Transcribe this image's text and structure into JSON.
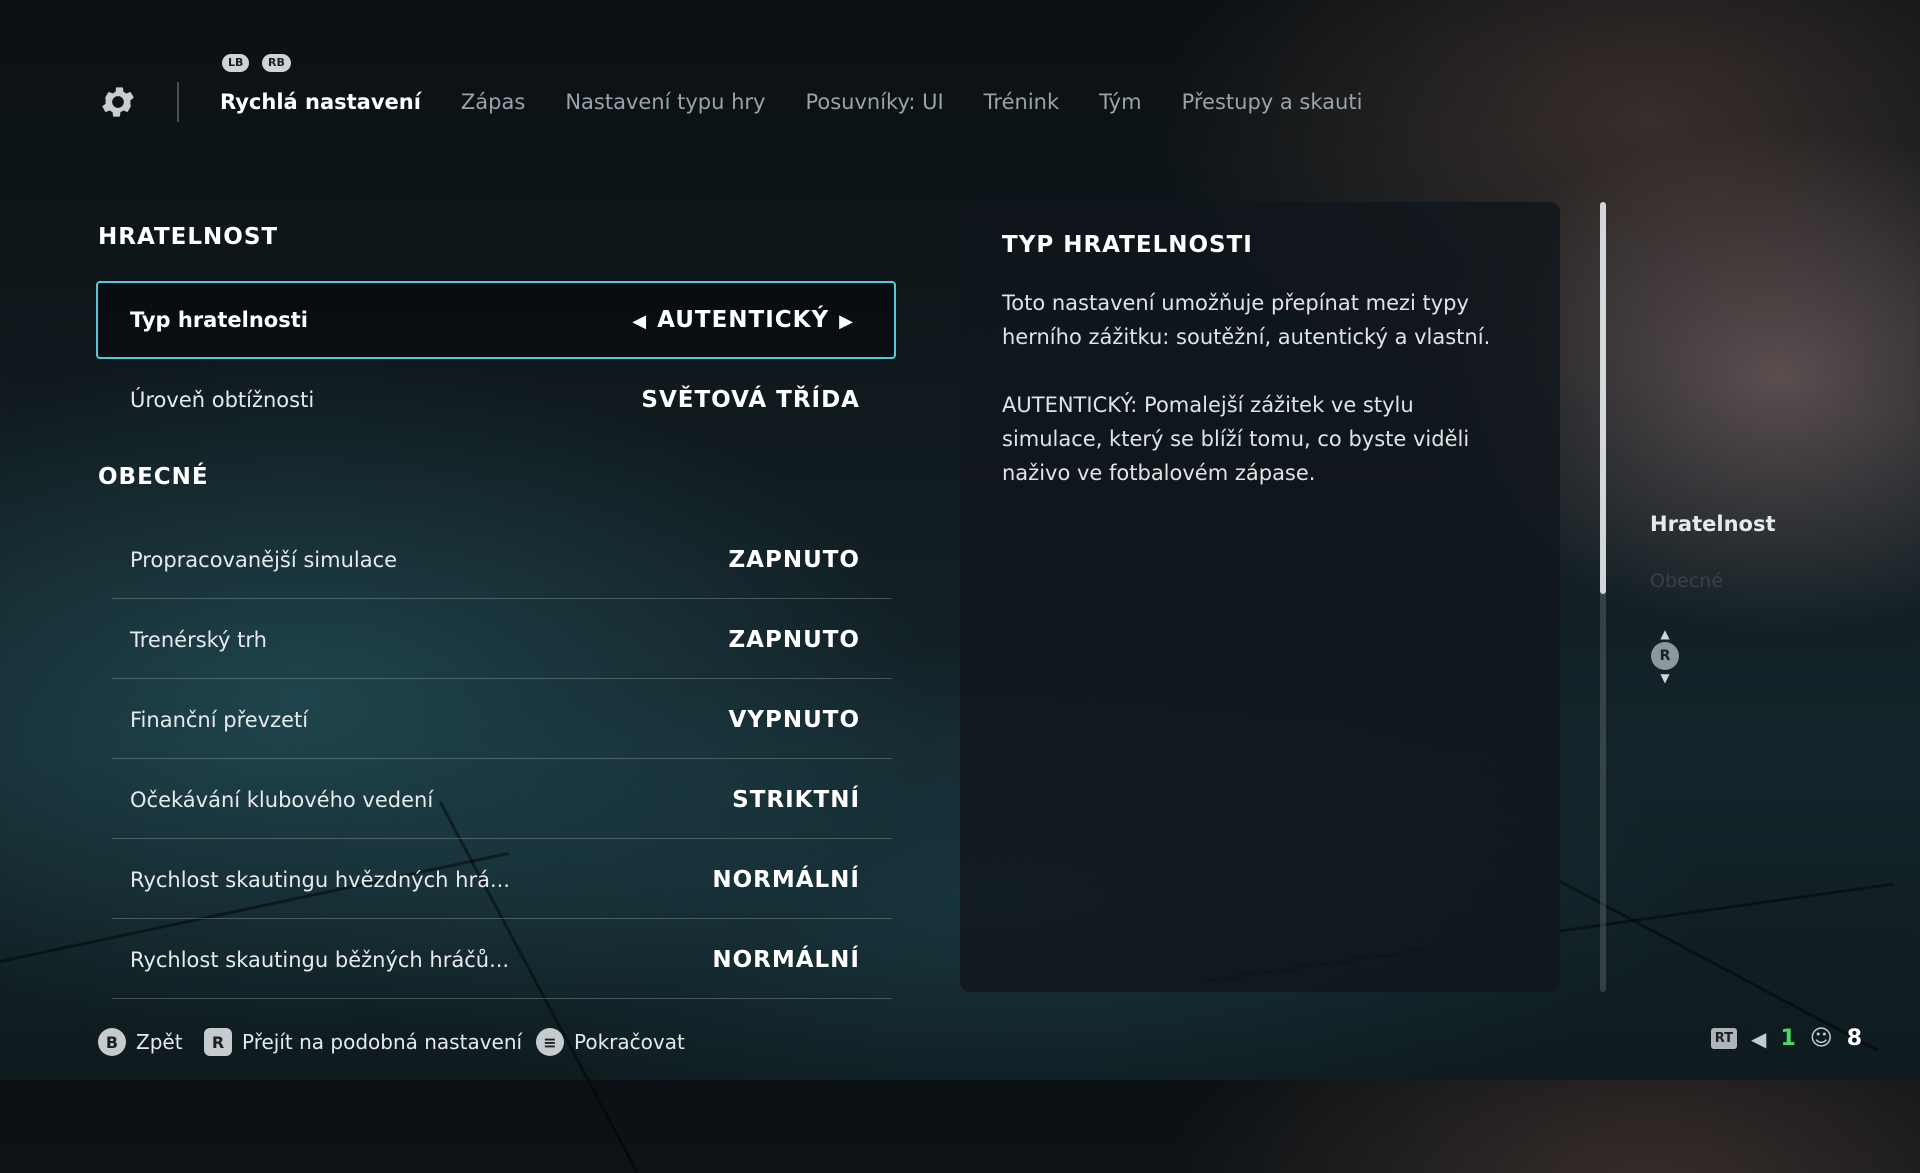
{
  "bumpers": {
    "left": "LB",
    "right": "RB"
  },
  "tabs": [
    {
      "label": "Rychlá nastavení",
      "active": true
    },
    {
      "label": "Zápas"
    },
    {
      "label": "Nastavení typu hry"
    },
    {
      "label": "Posuvníky: UI"
    },
    {
      "label": "Trénink"
    },
    {
      "label": "Tým"
    },
    {
      "label": "Přestupy a skauti"
    }
  ],
  "sections": {
    "gameplay": {
      "title": "HRATELNOST",
      "rows": [
        {
          "label": "Typ hratelnosti",
          "value": "AUTENTICKÝ"
        },
        {
          "label": "Úroveň obtížnosti",
          "value": "SVĚTOVÁ TŘÍDA"
        }
      ]
    },
    "general": {
      "title": "OBECNÉ",
      "rows": [
        {
          "label": "Propracovanější simulace",
          "value": "ZAPNUTO"
        },
        {
          "label": "Trenérský trh",
          "value": "ZAPNUTO"
        },
        {
          "label": "Finanční převzetí",
          "value": "VYPNUTO"
        },
        {
          "label": "Očekávání klubového vedení",
          "value": "STRIKTNÍ"
        },
        {
          "label": "Rychlost skautingu hvězdných hrá...",
          "value": "NORMÁLNÍ"
        },
        {
          "label": "Rychlost skautingu běžných hráčů...",
          "value": "NORMÁLNÍ"
        }
      ]
    }
  },
  "description": {
    "title": "TYP HRATELNOSTI",
    "para1": "Toto nastavení umožňuje přepínat mezi typy herního zážitku: soutěžní, autentický a vlastní.",
    "para2": "AUTENTICKÝ: Pomalejší zážitek ve stylu simulace, který se blíží tomu, co byste viděli naživo ve fotbalovém zápase."
  },
  "side_nav": {
    "active": "Hratelnost",
    "dim": "Obecné",
    "stick": "R"
  },
  "bottom_hints": {
    "back": {
      "button": "B",
      "label": "Zpět"
    },
    "similar": {
      "button": "R",
      "label": "Přejít na podobná nastavení"
    },
    "continue": {
      "button": "≡",
      "label": "Pokračovat"
    }
  },
  "status": {
    "rt": "RT",
    "count1": "1",
    "count2": "8"
  },
  "colors": {
    "accent": "#58c7d6",
    "green": "#4cd964"
  }
}
